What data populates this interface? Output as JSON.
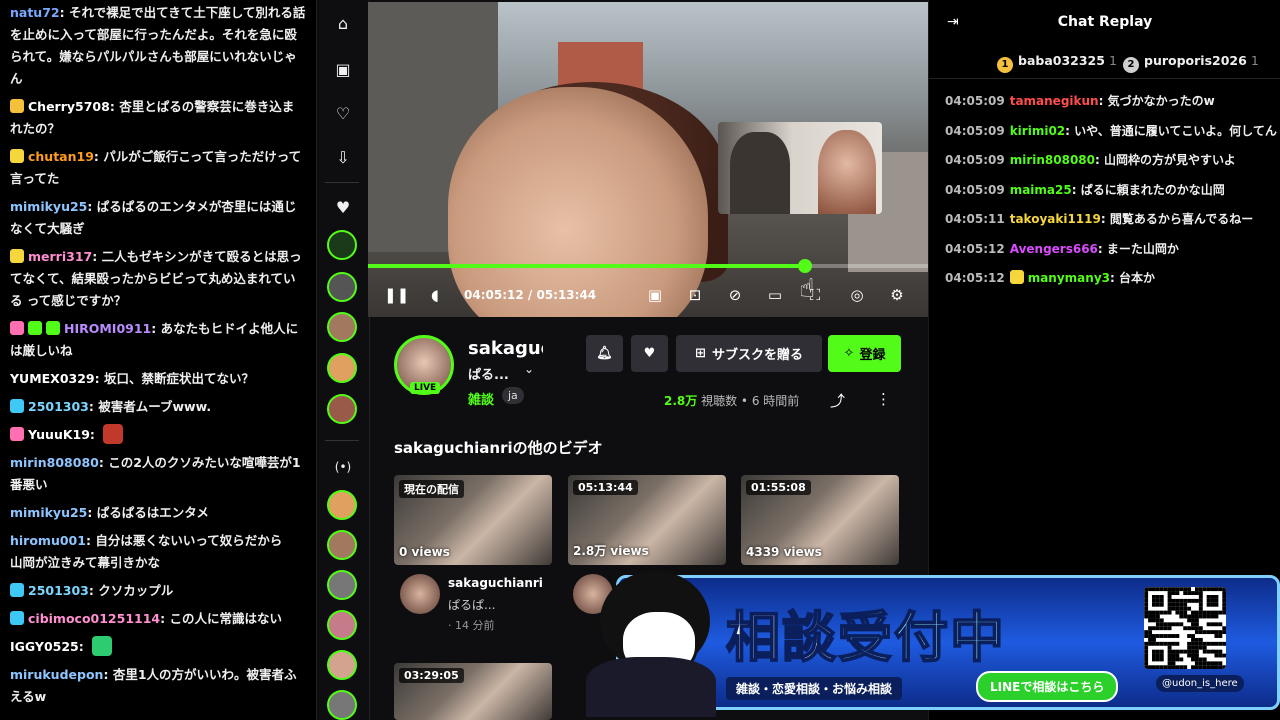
{
  "left_chat": [
    {
      "user": "natu72",
      "color": "#7aa7ff",
      "badges": [],
      "text": "それで裸足で出てきて土下座して別れる話を止めに入って部屋に行ったんだよ。それを急に殴られて。嫌ならパルパルさんも部屋にいれないじゃん"
    },
    {
      "user": "Cherry5708",
      "color": "#ffffff",
      "badges": [
        "#f5c13d"
      ],
      "text": "杏里とぱるの警察芸に巻き込まれたの？"
    },
    {
      "user": "chutan19",
      "color": "#ff9d1e",
      "badges": [
        "#f5d63d"
      ],
      "text": "パルがご飯行こって言っただけって言ってた"
    },
    {
      "user": "mimikyu25",
      "color": "#8ec5ff",
      "badges": [],
      "text": "ぱるぱるのエンタメが杏里には通じなくて大騒ぎ"
    },
    {
      "user": "merri317",
      "color": "#ff8fd1",
      "badges": [
        "#f5d63d"
      ],
      "text": "二人もゼキシンがきて殴るとは思ってなくて、結果殴ったからビビって丸め込まれている って感じですか？"
    },
    {
      "user": "HIROMI0911",
      "color": "#b98cff",
      "badges": [
        "#ff6fb1",
        "#53fc18",
        "#53fc18"
      ],
      "text": "あなたもヒドイよ他人には厳しいね"
    },
    {
      "user": "YUMEX0329",
      "color": "#ffffff",
      "badges": [],
      "text": "坂口、禁断症状出てない？"
    },
    {
      "user": "2501303",
      "color": "#7ad7ff",
      "badges": [
        "#3dc8f5"
      ],
      "text": "被害者ムーブwww."
    },
    {
      "user": "YuuuK19",
      "color": "#ffffff",
      "badges": [
        "#ff6fb1"
      ],
      "text": ""
    },
    {
      "user": "mirin808080",
      "color": "#8ec5ff",
      "badges": [],
      "text": "この2人のクソみたいな喧嘩芸が1番悪い"
    },
    {
      "user": "mimikyu25",
      "color": "#8ec5ff",
      "badges": [],
      "text": "ぱるぱるはエンタメ"
    },
    {
      "user": "hiromu001",
      "color": "#8ec5ff",
      "badges": [],
      "text": "自分は悪くないいって奴らだから　山岡が泣きみて幕引きかな"
    },
    {
      "user": "2501303",
      "color": "#7ad7ff",
      "badges": [
        "#3dc8f5"
      ],
      "text": "クソカップル"
    },
    {
      "user": "cibimoco01251114",
      "color": "#ff8fd1",
      "badges": [
        "#3dc8f5"
      ],
      "text": "この人に常識はない"
    },
    {
      "user": "IGGY0525",
      "color": "#ffffff",
      "badges": [],
      "text": ""
    },
    {
      "user": "mirukudepon",
      "color": "#8ec5ff",
      "badges": [],
      "text": "杏里1人の方がいいわ。被害者ふえるw"
    }
  ],
  "video": {
    "current_time": "04:05:12",
    "duration": "05:13:44",
    "progress_fraction": 0.78
  },
  "channel": {
    "name": "sakaguc",
    "subtitle": "ぱる...",
    "live_label": "LIVE",
    "category": "雑談",
    "language": "ja",
    "sub_button": "サブスクを贈る",
    "follow_button": "登録",
    "views_count": "2.8万",
    "views_label": "視聴数",
    "time_ago": "6 時間前"
  },
  "other_videos_title": "sakaguchianriの他のビデオ",
  "videos": [
    {
      "badge": "現在の配信",
      "views": "0 views",
      "channel": "sakaguchianri",
      "sub": "ぱるぱ...",
      "meta": "· 14 分前"
    },
    {
      "badge": "05:13:44",
      "views": "2.8万 views"
    },
    {
      "badge": "01:55:08",
      "views": "4339 views"
    },
    {
      "badge": "03:29:05",
      "views": ""
    }
  ],
  "right_chat": {
    "title": "Chat Replay",
    "top": [
      {
        "rank": "1",
        "name": "baba032325",
        "count": "1",
        "color": "#f5c13d"
      },
      {
        "rank": "2",
        "name": "puroporis2026",
        "count": "1",
        "color": "#cfcfcf"
      }
    ],
    "messages": [
      {
        "time": "04:05:09",
        "user": "tamanegikun",
        "color": "#ff4d4d",
        "badge": "",
        "text": "気づかなかったのw"
      },
      {
        "time": "04:05:09",
        "user": "kirimi02",
        "color": "#53fc18",
        "badge": "",
        "text": "いや、普通に履いてこいよ。何してん"
      },
      {
        "time": "04:05:09",
        "user": "mirin808080",
        "color": "#53fc18",
        "badge": "",
        "text": "山岡枠の方が見やすいよ"
      },
      {
        "time": "04:05:09",
        "user": "maima25",
        "color": "#53fc18",
        "badge": "",
        "text": "ぱるに頼まれたのかな山岡"
      },
      {
        "time": "04:05:11",
        "user": "takoyaki1119",
        "color": "#f5d63d",
        "badge": "",
        "text": "閲覧あるから喜んでるねー"
      },
      {
        "time": "04:05:12",
        "user": "Avengers666",
        "color": "#d94dff",
        "badge": "",
        "text": "まーた山岡か"
      },
      {
        "time": "04:05:12",
        "user": "manymany3",
        "color": "#53fc18",
        "badge": "#f5d63d",
        "text": "台本か"
      }
    ]
  },
  "banner": {
    "title_a": "相談",
    "title_b": "受付中",
    "subtitle": "雑談・恋愛相談・お悩み相談",
    "line_label": "LINEで相談はこちら",
    "handle": "@udon_is_here"
  },
  "icons": {
    "home": "home-icon",
    "browse": "browse-icon",
    "following": "heart-icon",
    "downloads": "download-icon",
    "play": "pause-icon",
    "volume": "volume-icon",
    "share": "share-icon",
    "more": "more-icon",
    "bell": "bell-icon",
    "gift": "gift-icon"
  },
  "colors": {
    "accent": "#53fc18",
    "background": "#0e0e10"
  }
}
